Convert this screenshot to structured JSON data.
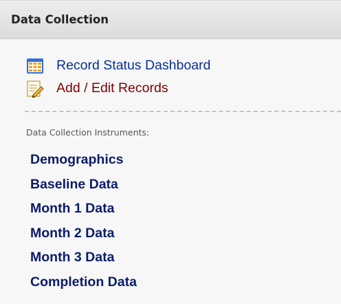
{
  "panel": {
    "title": "Data Collection"
  },
  "links": {
    "record_status_dashboard": "Record Status Dashboard",
    "add_edit_records": "Add / Edit Records"
  },
  "instruments": {
    "heading": "Data Collection Instruments:",
    "items": [
      {
        "label": "Demographics"
      },
      {
        "label": "Baseline Data"
      },
      {
        "label": "Month 1 Data"
      },
      {
        "label": "Month 2 Data"
      },
      {
        "label": "Month 3 Data"
      },
      {
        "label": "Completion Data"
      }
    ]
  },
  "icons": {
    "dashboard": "table-grid-icon",
    "add_edit": "pencil-document-icon"
  },
  "colors": {
    "link_blue": "#0a2f96",
    "link_red": "#800000",
    "instrument_navy": "#0b1c6b"
  }
}
